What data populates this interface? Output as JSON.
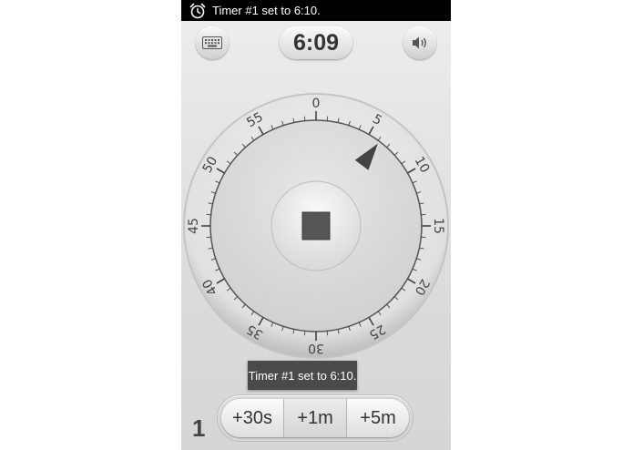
{
  "status_bar": {
    "notification_text": "Timer #1 set to 6:10.",
    "icon": "alarm-clock-icon"
  },
  "top_bar": {
    "keyboard_icon": "keyboard-icon",
    "time_display": "6:09",
    "volume_icon": "volume-icon"
  },
  "dial": {
    "labels": [
      "0",
      "5",
      "10",
      "15",
      "20",
      "25",
      "30",
      "35",
      "40",
      "45",
      "50",
      "55"
    ],
    "remaining_minutes": 6.15,
    "center_button_icon": "stop-icon"
  },
  "toast": {
    "text": "Timer #1 set to 6:10."
  },
  "timer_count": "1",
  "add_buttons": [
    "+30s",
    "+1m",
    "+5m"
  ],
  "colors": {
    "status_bar": "#000000",
    "toast_bg": "#4a4a4a",
    "pointer": "#444444",
    "stop_square": "#555555"
  }
}
